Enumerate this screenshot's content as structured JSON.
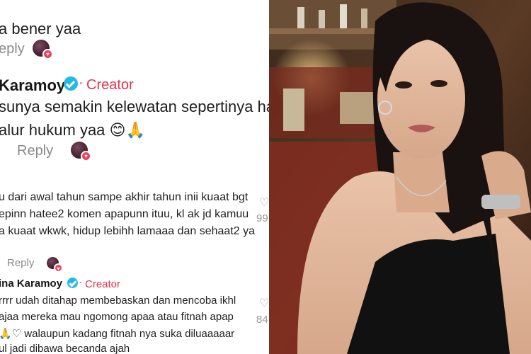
{
  "comments": {
    "c1": {
      "text": "a bener yaa",
      "reply": "eply"
    },
    "c2": {
      "author": "Karamoy",
      "badge": "Creator",
      "line1": "sunya semakin kelewatan sepertinya har",
      "line2": "alur hukum yaa 😊🙏",
      "reply": "Reply"
    },
    "c3": {
      "line1": "u dari awal tahun sampe akhir tahun inii kuaat bgt",
      "line2": "epinn hatee2 komen apapunn ituu, kl ak jd kamuu",
      "line3": "a kuaat wkwk, hidup lebihh lamaaa dan sehaat2 ya",
      "reply": "Reply",
      "likes": "99"
    },
    "c4": {
      "author": "ina Karamoy",
      "badge": "Creator",
      "line1": "rrrr udah ditahap membebaskan dan mencoba ikhl",
      "line2": "ajaa mereka mau ngomong apaa atau fitnah apap",
      "line3": "🙏♡ walaupun kadang fitnah nya suka diluaaaaar",
      "line4": "ul jadi dibawa becanda ajah",
      "likes": "84"
    }
  },
  "colors": {
    "creator": "#e8334a",
    "verified": "#22b8e8",
    "reply": "#8a8a8a"
  },
  "icons": [
    "verified-badge-icon",
    "heart-icon",
    "like-heart-icon"
  ]
}
